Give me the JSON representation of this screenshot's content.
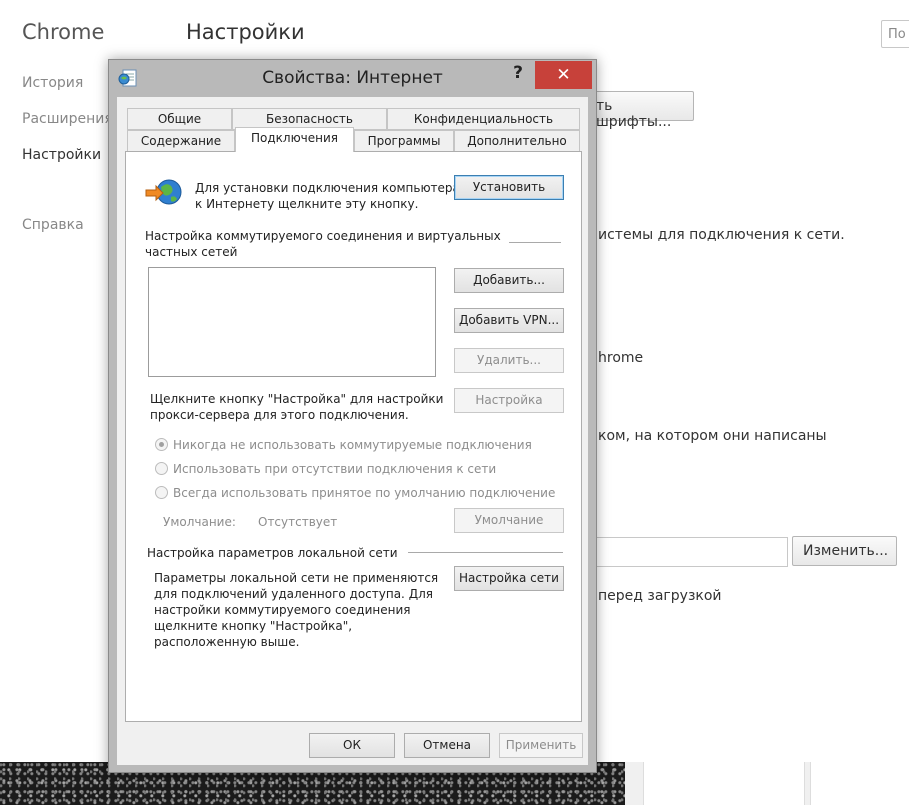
{
  "background": {
    "brand": "Chrome",
    "title": "Настройки",
    "search_placeholder": "По",
    "sidebar": [
      "История",
      "Расширения",
      "Настройки",
      "Справка"
    ],
    "fonts_button": "ть шрифты...",
    "text_network": "истемы для подключения к сети.",
    "text_chrome": "hrome",
    "text_language": "ком, на котором они написаны",
    "change_button": "Изменить...",
    "text_download": "перед загрузкой"
  },
  "dialog": {
    "title": "Свойства: Интернет",
    "help": "?",
    "close": "✕",
    "tabs_row1": [
      "Общие",
      "Безопасность",
      "Конфиденциальность"
    ],
    "tabs_row2": [
      "Содержание",
      "Подключения",
      "Программы",
      "Дополнительно"
    ],
    "selected_tab": "Подключения",
    "setup_text_1": "Для установки подключения компьютера",
    "setup_text_2": "к Интернету щелкните эту кнопку.",
    "setup_button": "Установить",
    "dialup_header_1": "Настройка коммутируемого соединения и виртуальных",
    "dialup_header_2": "частных сетей",
    "add_button": "Добавить...",
    "add_vpn_button": "Добавить VPN...",
    "remove_button": "Удалить...",
    "proxy_text_1": "Щелкните кнопку \"Настройка\" для настройки",
    "proxy_text_2": "прокси-сервера для этого подключения.",
    "settings_button": "Настройка",
    "radio_options": [
      "Никогда не использовать коммутируемые подключения",
      "Использовать при отсутствии подключения к сети",
      "Всегда использовать принятое по умолчанию подключение"
    ],
    "default_label": "Умолчание:",
    "default_value": "Отсутствует",
    "default_button": "Умолчание",
    "lan_header": "Настройка параметров локальной сети",
    "lan_text": [
      "Параметры локальной сети не применяются",
      "для подключений удаленного доступа. Для",
      "настройки коммутируемого соединения",
      "щелкните кнопку \"Настройка\",",
      "расположенную выше."
    ],
    "lan_button": "Настройка сети",
    "ok_button": "ОК",
    "cancel_button": "Отмена",
    "apply_button": "Применить"
  }
}
